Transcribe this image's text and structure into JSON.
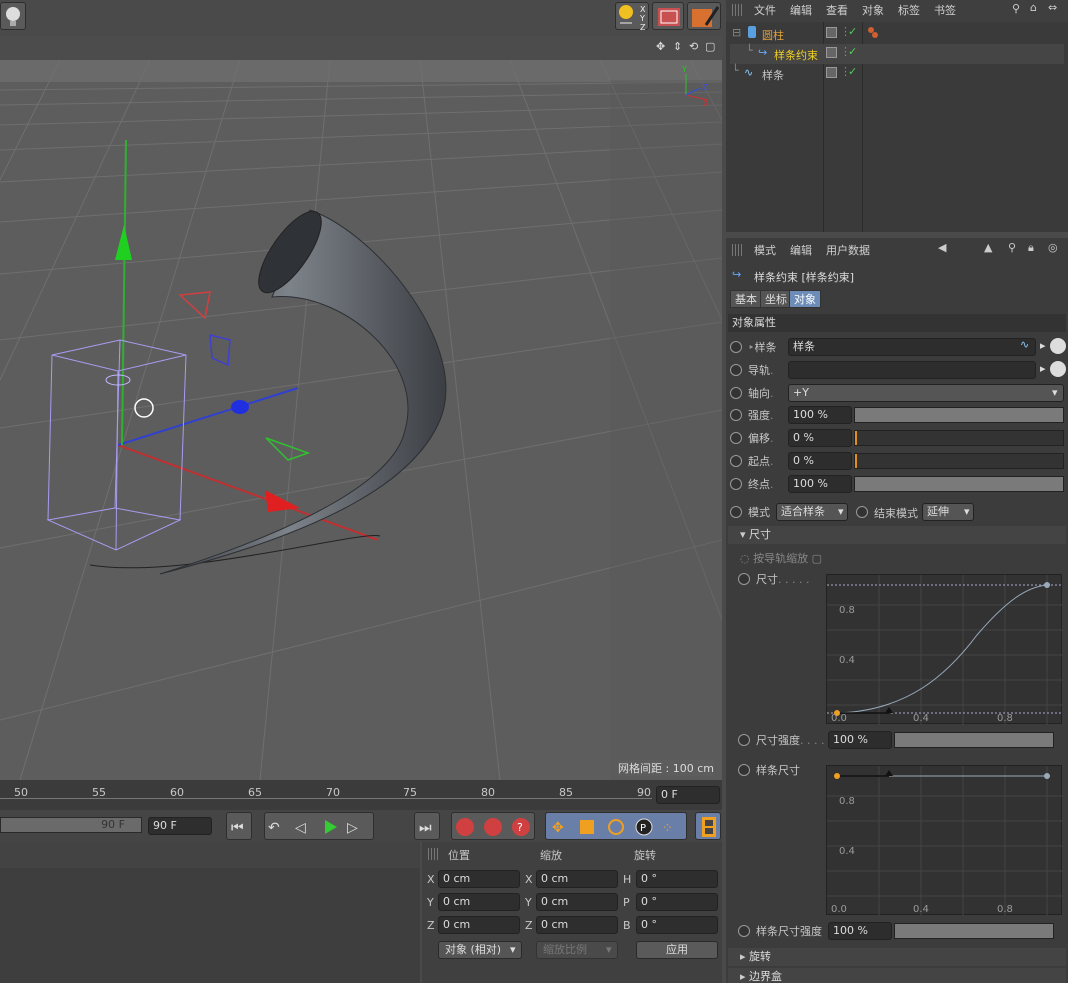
{
  "viewport": {
    "grid_spacing": "网格间距 : 100 cm",
    "axis_labels": {
      "x": "X",
      "y": "Y",
      "z": "Z"
    },
    "grid_color": "#6a6a6a",
    "background": "#5d5d5d"
  },
  "object_manager": {
    "menu": [
      "文件",
      "编辑",
      "查看",
      "对象",
      "标签",
      "书签"
    ],
    "objects": [
      {
        "name": "圆柱",
        "color": "#e0a040"
      },
      {
        "name": "样条约束",
        "color": "#f0d020"
      },
      {
        "name": "样条",
        "color": "#d0d0d0"
      }
    ]
  },
  "attribute_manager": {
    "menu": [
      "模式",
      "编辑",
      "用户数据"
    ],
    "title": "样条约束 [样条约束]",
    "tabs": [
      "基本",
      "坐标",
      "对象"
    ],
    "section": "对象属性",
    "props": [
      {
        "label": "样条",
        "value": "样条"
      },
      {
        "label": "导轨",
        "value": ""
      },
      {
        "label": "轴向",
        "value": "+Y"
      },
      {
        "label": "强度",
        "value": "100 %",
        "fill": 1.0
      },
      {
        "label": "偏移",
        "value": "0 %",
        "fill": 0.0
      },
      {
        "label": "起点",
        "value": "0 %",
        "fill": 0.0
      },
      {
        "label": "终点",
        "value": "100 %",
        "fill": 1.0
      }
    ],
    "mode_label": "模式",
    "mode_value": "适合样条",
    "end_mode_label": "结束模式",
    "end_mode_value": "延伸",
    "size_group": "尺寸",
    "scale_along_rail": "按导轨缩放",
    "size_label": "尺寸",
    "size_strength_label": "尺寸强度",
    "size_strength_value": "100 %",
    "spline_size_label": "样条尺寸",
    "spline_size_strength_label": "样条尺寸强度",
    "spline_size_strength_value": "100 %",
    "graph_ticks_y": [
      "0.8",
      "0.4",
      "0.0"
    ],
    "graph_ticks_x": [
      "0.4",
      "0.8"
    ],
    "rotate_group": "旋转",
    "boundary_group": "边界盒"
  },
  "timeline": {
    "ticks": [
      "50",
      "55",
      "60",
      "65",
      "70",
      "75",
      "80",
      "85",
      "90"
    ],
    "current_frame": "0 F",
    "end_frame_a": "90 F",
    "end_frame_b": "90 F"
  },
  "coords": {
    "headers": [
      "位置",
      "缩放",
      "旋转"
    ],
    "rows": [
      {
        "a": "X",
        "av": "0 cm",
        "b": "X",
        "bv": "0 cm",
        "c": "H",
        "cv": "0 °"
      },
      {
        "a": "Y",
        "av": "0 cm",
        "b": "Y",
        "bv": "0 cm",
        "c": "P",
        "cv": "0 °"
      },
      {
        "a": "Z",
        "av": "0 cm",
        "b": "Z",
        "bv": "0 cm",
        "c": "B",
        "cv": "0 °"
      }
    ],
    "mode": "对象 (相对)",
    "scale_mode": "缩放比例",
    "apply": "应用"
  }
}
